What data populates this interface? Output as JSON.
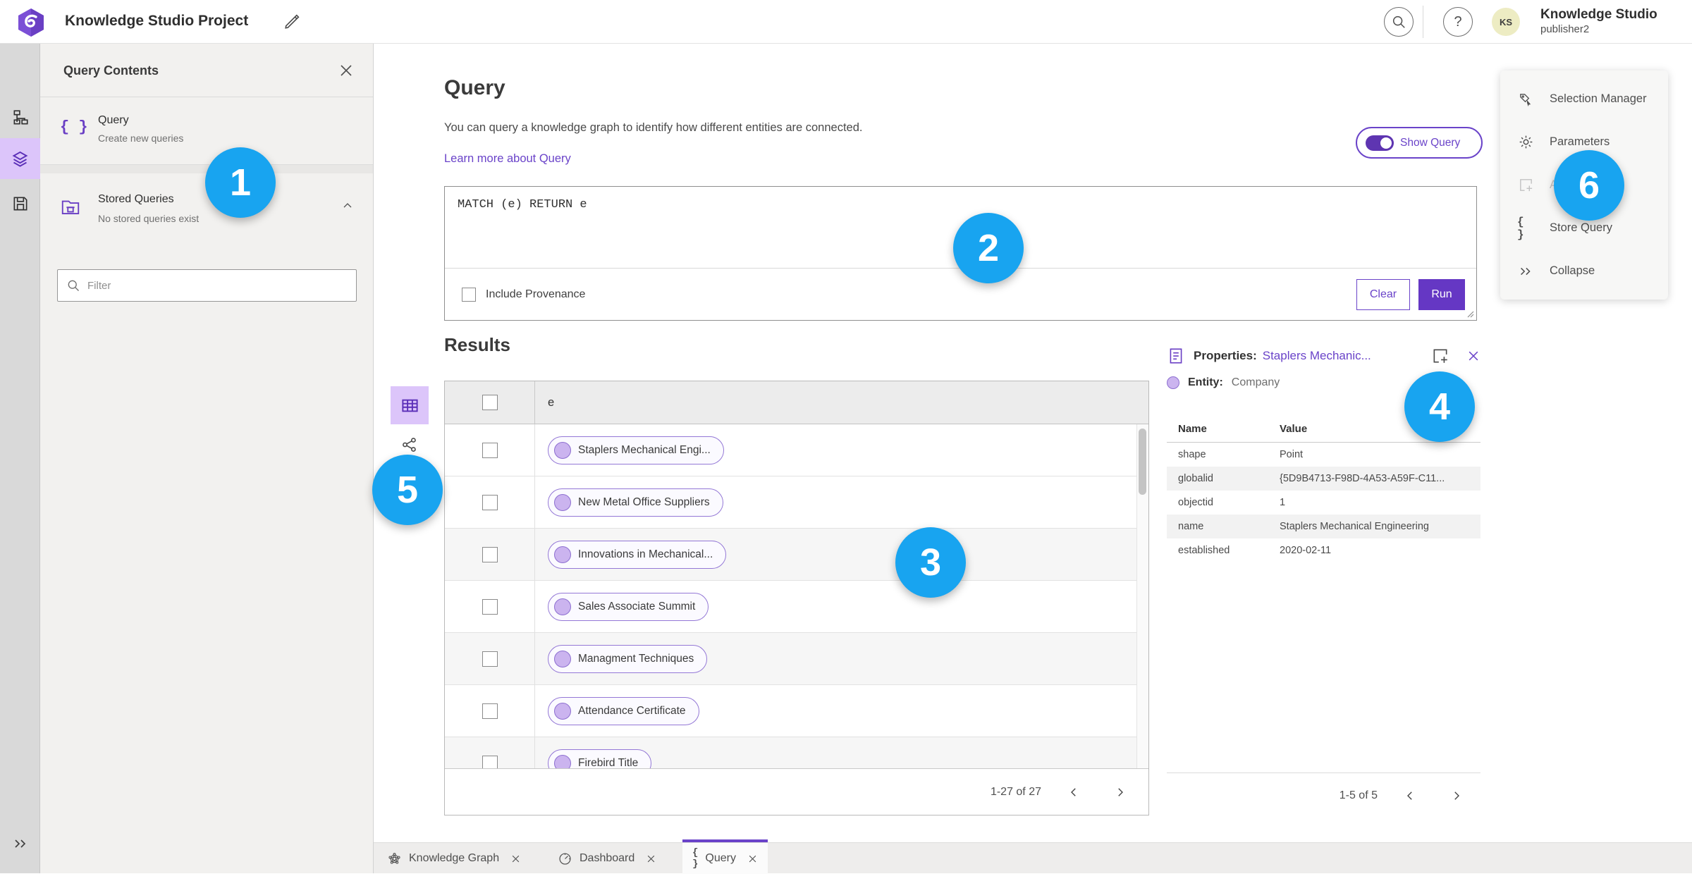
{
  "topbar": {
    "title": "Knowledge Studio Project",
    "user_name": "Knowledge Studio",
    "user_role": "publisher2",
    "avatar_initials": "KS"
  },
  "contents_panel": {
    "title": "Query Contents",
    "query_item": {
      "label": "Query",
      "sublabel": "Create new queries"
    },
    "stored_item": {
      "label": "Stored Queries",
      "sublabel": "No stored queries exist"
    },
    "filter_placeholder": "Filter"
  },
  "query_section": {
    "title": "Query",
    "description": "You can query a knowledge graph to identify how different entities are connected.",
    "learn_more": "Learn more about Query",
    "show_query_label": "Show Query",
    "query_text": "MATCH (e) RETURN e",
    "include_provenance_label": "Include Provenance",
    "clear_label": "Clear",
    "run_label": "Run"
  },
  "results": {
    "title": "Results",
    "column_header": "e",
    "rows": [
      "Staplers Mechanical Engi...",
      "New Metal Office Suppliers",
      "Innovations in Mechanical...",
      "Sales Associate Summit",
      "Managment Techniques",
      "Attendance Certificate",
      "Firebird Title"
    ],
    "pagination": "1-27 of 27"
  },
  "properties": {
    "title": "Properties:",
    "entity_link": "Staplers Mechanic...",
    "entity_label": "Entity:",
    "entity_type": "Company",
    "table": {
      "headers": [
        "Name",
        "Value"
      ],
      "rows": [
        [
          "shape",
          "Point"
        ],
        [
          "globalid",
          "{5D9B4713-F98D-4A53-A59F-C11..."
        ],
        [
          "objectid",
          "1"
        ],
        [
          "name",
          "Staplers Mechanical Engineering"
        ],
        [
          "established",
          "2020-02-11"
        ]
      ]
    },
    "pagination": "1-5 of 5"
  },
  "side_menu": {
    "items": [
      "Selection Manager",
      "Parameters",
      "Ad",
      "Store Query",
      "Collapse"
    ]
  },
  "tabs": [
    {
      "label": "Knowledge Graph"
    },
    {
      "label": "Dashboard"
    },
    {
      "label": "Query",
      "active": true
    }
  ],
  "callouts": [
    "1",
    "2",
    "3",
    "4",
    "5",
    "6"
  ],
  "colors": {
    "accent": "#6a43c9",
    "accent_light": "#dcc5fa",
    "callout_blue": "#18a4f0",
    "avatar_bg": "#edecc3"
  }
}
